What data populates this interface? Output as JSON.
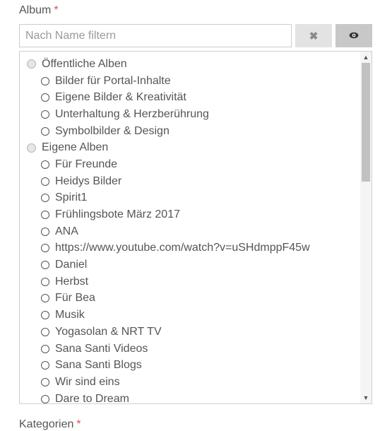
{
  "album": {
    "label": "Album",
    "required_marker": "*",
    "filter": {
      "placeholder": "Nach Name filtern",
      "value": ""
    },
    "clear_button": "✖",
    "view_button": "eye-icon"
  },
  "album_list": [
    {
      "label": "Öffentliche Alben",
      "level": "group"
    },
    {
      "label": "Bilder für Portal-Inhalte",
      "level": "child"
    },
    {
      "label": "Eigene Bilder & Kreativität",
      "level": "child"
    },
    {
      "label": "Unterhaltung & Herzberührung",
      "level": "child"
    },
    {
      "label": "Symbolbilder & Design",
      "level": "child"
    },
    {
      "label": "Eigene Alben",
      "level": "group"
    },
    {
      "label": "Für Freunde",
      "level": "child"
    },
    {
      "label": "Heidys Bilder",
      "level": "child"
    },
    {
      "label": "Spirit1",
      "level": "child"
    },
    {
      "label": "Frühlingsbote März 2017",
      "level": "child"
    },
    {
      "label": "ANA",
      "level": "child"
    },
    {
      "label": "https://www.youtube.com/watch?v=uSHdmppF45w",
      "level": "child"
    },
    {
      "label": "Daniel",
      "level": "child"
    },
    {
      "label": "Herbst",
      "level": "child"
    },
    {
      "label": "Für Bea",
      "level": "child"
    },
    {
      "label": "Musik",
      "level": "child"
    },
    {
      "label": "Yogasolan & NRT TV",
      "level": "child"
    },
    {
      "label": "Sana Santi Videos",
      "level": "child"
    },
    {
      "label": "Sana Santi Blogs",
      "level": "child"
    },
    {
      "label": "Wir sind eins",
      "level": "child"
    },
    {
      "label": "Dare to Dream",
      "level": "child"
    }
  ],
  "scrollbar": {
    "up": "▲",
    "down": "▼"
  },
  "categories": {
    "label": "Kategorien",
    "required_marker": "*"
  }
}
